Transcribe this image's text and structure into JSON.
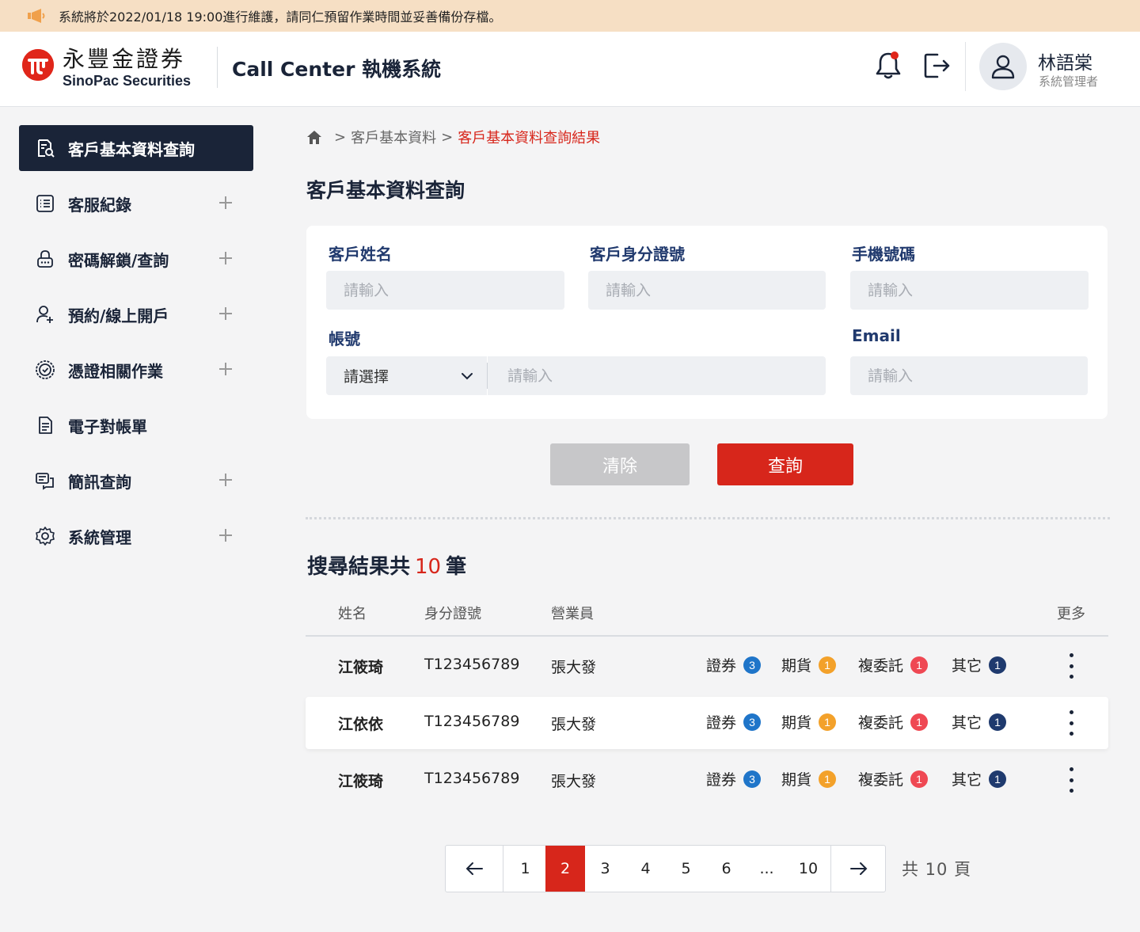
{
  "announcement": "系統將於2022/01/18 19:00進行維護，請同仁預留作業時間並妥善備份存檔。",
  "brand": {
    "name_cn": "永豐金證券",
    "name_en": "SinoPac Securities",
    "color": "#e0261a"
  },
  "app_title": "Call Center 執機系統",
  "user": {
    "name": "林語棠",
    "role": "系統管理者"
  },
  "sidebar": {
    "items": [
      {
        "label": "客戶基本資料查詢",
        "icon": "search-document-icon",
        "active": true,
        "expandable": false
      },
      {
        "label": "客服紀錄",
        "icon": "list-icon",
        "expandable": true
      },
      {
        "label": "密碼解鎖/查詢",
        "icon": "lock-icon",
        "expandable": true
      },
      {
        "label": "預約/線上開戶",
        "icon": "user-add-icon",
        "expandable": true
      },
      {
        "label": "憑證相關作業",
        "icon": "certificate-icon",
        "expandable": true
      },
      {
        "label": "電子對帳單",
        "icon": "document-icon",
        "expandable": false
      },
      {
        "label": "簡訊查詢",
        "icon": "message-icon",
        "expandable": true
      },
      {
        "label": "系統管理",
        "icon": "gear-icon",
        "expandable": true
      }
    ]
  },
  "breadcrumb": {
    "items": [
      "客戶基本資料",
      "客戶基本資料查詢結果"
    ],
    "separator": ">"
  },
  "page_title": "客戶基本資料查詢",
  "form": {
    "name_label": "客戶姓名",
    "id_label": "客戶身分證號",
    "mobile_label": "手機號碼",
    "account_label": "帳號",
    "email_label": "Email",
    "placeholder": "請輸入",
    "account_select": "請選擇"
  },
  "buttons": {
    "clear": "清除",
    "search": "查詢"
  },
  "results": {
    "prefix": "搜尋結果共",
    "count": "10",
    "suffix": "筆",
    "headers": {
      "name": "姓名",
      "id": "身分證號",
      "agent": "營業員",
      "more": "更多"
    },
    "tag_labels": [
      "證券",
      "期貨",
      "複委託",
      "其它"
    ],
    "tag_colors": [
      "#1f75c9",
      "#f3a12a",
      "#ef4853",
      "#1f3a6e"
    ],
    "rows": [
      {
        "name": "江筱琦",
        "id": "T123456789",
        "agent": "張大發",
        "counts": [
          "3",
          "1",
          "1",
          "1"
        ]
      },
      {
        "name": "江依依",
        "id": "T123456789",
        "agent": "張大發",
        "counts": [
          "3",
          "1",
          "1",
          "1"
        ]
      },
      {
        "name": "江筱琦",
        "id": "T123456789",
        "agent": "張大發",
        "counts": [
          "3",
          "1",
          "1",
          "1"
        ]
      }
    ]
  },
  "pagination": {
    "prev": "←",
    "next": "→",
    "pages": [
      "1",
      "2",
      "3",
      "4",
      "5",
      "6",
      "...",
      "10"
    ],
    "current": "2",
    "total_text": "共 10 頁"
  }
}
